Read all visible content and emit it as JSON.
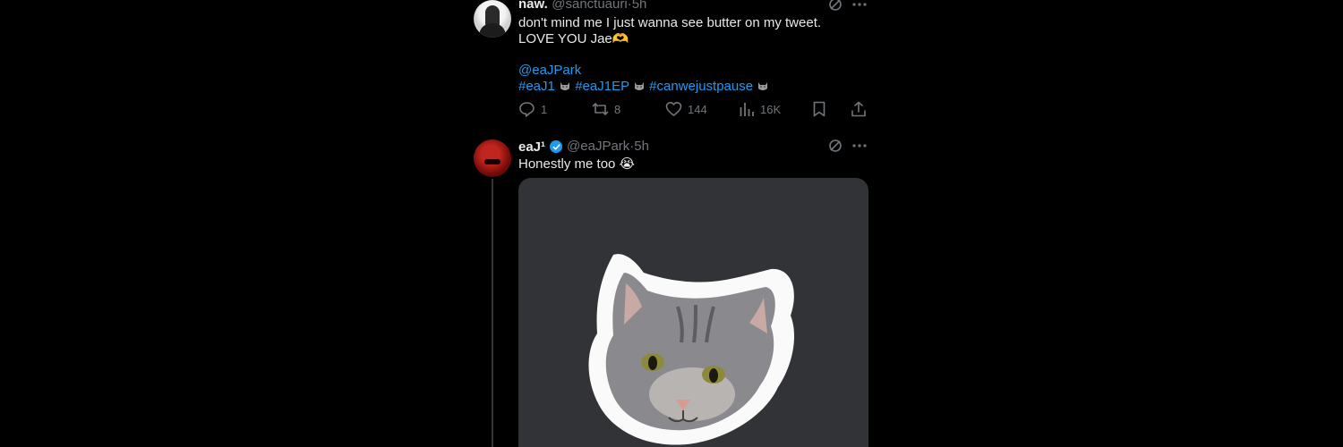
{
  "tweet1": {
    "name": "naw.",
    "handle": "@sanctuauri",
    "separator": "·",
    "time": "5h",
    "text": "don't mind me I just wanna see butter on my tweet. LOVE YOU Jae🫶",
    "mention": "@eaJPark",
    "hashtags": [
      "#eaJ1",
      "#eaJ1EP",
      "#canwejustpause"
    ],
    "actions": {
      "replies": "1",
      "reposts": "8",
      "likes": "144",
      "views": "16K"
    }
  },
  "tweet2": {
    "name": "eaJ¹",
    "handle": "@eaJPark",
    "separator": "·",
    "time": "5h",
    "text": "Honestly me too 😭",
    "media_alt": "cat sticker image"
  },
  "colors": {
    "background": "#000000",
    "text": "#e7e9ea",
    "secondary": "#71767b",
    "accent": "#1d9bf0",
    "media_bg": "#313336"
  },
  "icons": [
    "reply-icon",
    "repost-icon",
    "like-icon",
    "views-icon",
    "bookmark-icon",
    "share-icon",
    "grok-icon",
    "more-icon",
    "verified-icon"
  ]
}
